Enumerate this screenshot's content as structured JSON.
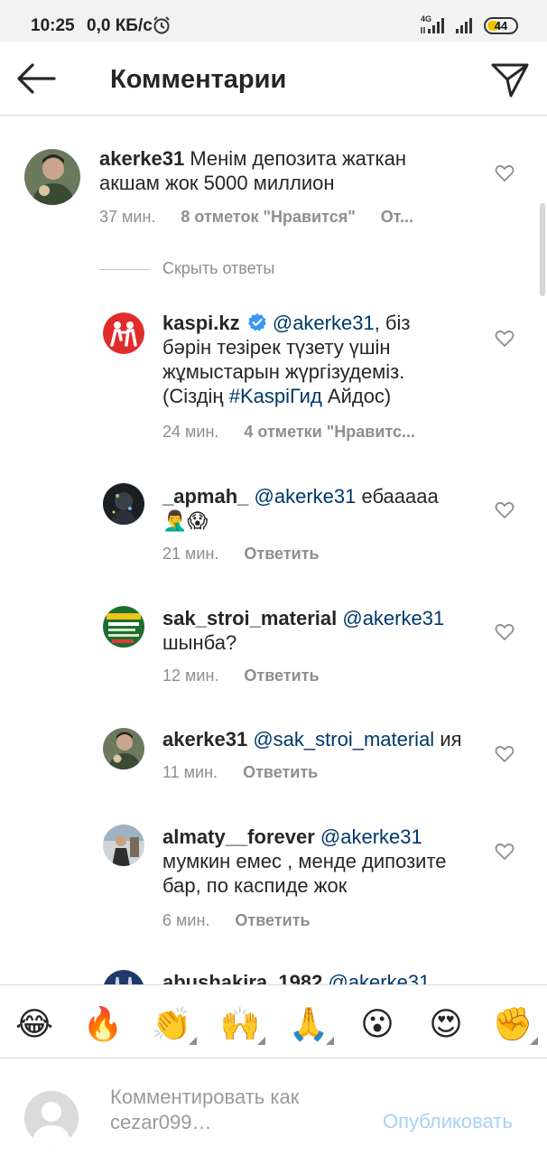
{
  "status_bar": {
    "time": "10:25",
    "speed": "0,0 КБ/с",
    "network": "4G",
    "battery": "44",
    "battery_level": 0.44,
    "battery_color": "#f2c200"
  },
  "header": {
    "title": "Комментарии",
    "back_icon": "arrow-left-icon",
    "send_icon": "paper-plane-icon"
  },
  "comments": [
    {
      "username": "akerke31",
      "text": "Менім депозита жаткан акшам жок 5000 миллион",
      "time": "37 мин.",
      "likes": "8 отметок \"Нравится\"",
      "reply": "От..."
    }
  ],
  "hide_replies": "Скрыть ответы",
  "replies": [
    {
      "username": "kaspi.kz",
      "verified": true,
      "mention": "@akerke31",
      "text_1": ", біз бәрін тезірек түзету үшін жұмыстарын жүргізудеміз. (Сіздің ",
      "hashtag": "#KaspiГид",
      "text_2": " Айдос)",
      "time": "24 мин.",
      "likes": "4 отметки \"Нравитс...",
      "brand_color": "#e12c2c"
    },
    {
      "username": "_apmah_",
      "mention": "@akerke31",
      "text": " ебааааа 🤦‍♂️😱",
      "time": "21 мин.",
      "reply": "Ответить"
    },
    {
      "username": "sak_stroi_material",
      "mention": "@akerke31",
      "text": " шынба?",
      "time": "12 мин.",
      "reply": "Ответить"
    },
    {
      "username": "akerke31",
      "mention": "@sak_stroi_material",
      "text": " ия",
      "time": "11 мин.",
      "reply": "Ответить"
    },
    {
      "username": "almaty__forever",
      "mention": "@akerke31",
      "text": " мумкин емес , менде дипозите бар, по каспиде жок",
      "time": "6 мин.",
      "reply": "Ответить"
    },
    {
      "username": "abushakira_1982",
      "mention": "@akerke31",
      "text": ""
    }
  ],
  "emoji_bar": [
    "😂",
    "🔥",
    "👏",
    "🙌",
    "🙏",
    "😮",
    "😍",
    "✊"
  ],
  "comment_input": {
    "placeholder": "Комментировать как cezar099…",
    "post_label": "Опубликовать"
  },
  "colors": {
    "mention": "#00376b",
    "secondary_text": "#8e8e8e",
    "post_button_disabled": "#a9d2f5"
  }
}
